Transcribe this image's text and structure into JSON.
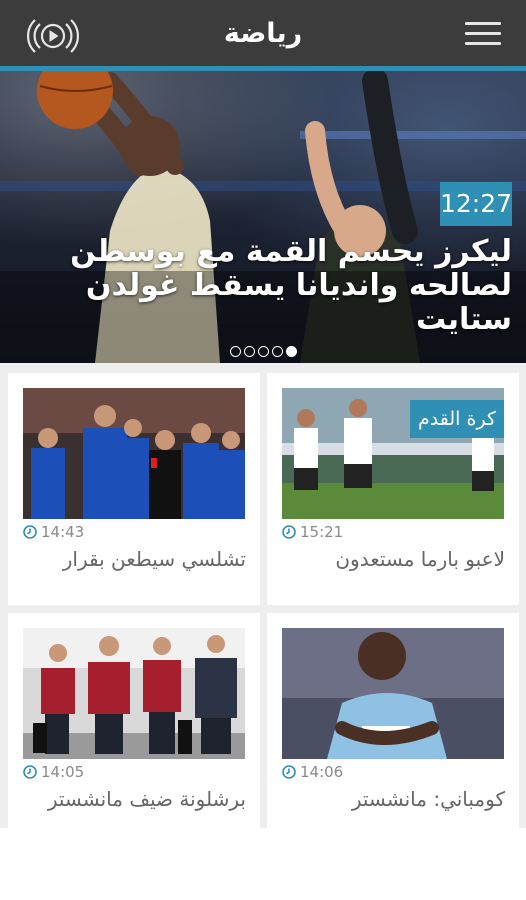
{
  "header": {
    "title": "رياضة",
    "radio_icon": "radio-play-icon",
    "menu_icon": "hamburger-menu-icon",
    "accent_color": "#2f8fb5",
    "bar_color": "#3c3c3c"
  },
  "hero": {
    "time": "12:27",
    "headline": "ليكرز يحسم القمة مع بوسطن لصالحه وانديانا يسقط غولدن ستايت",
    "slides_total": 5,
    "active_slide": 5
  },
  "articles": [
    {
      "time": "15:21",
      "headline": "لاعبو بارما مستعدون",
      "category": "كرة القدم",
      "clock_icon": "clock-icon"
    },
    {
      "time": "14:43",
      "headline": "تشلسي سيطعن بقرار",
      "clock_icon": "clock-icon"
    },
    {
      "time": "14:06",
      "headline": "كومباني: مانشستر",
      "clock_icon": "clock-icon"
    },
    {
      "time": "14:05",
      "headline": "برشلونة ضيف مانشستر",
      "clock_icon": "clock-icon"
    }
  ]
}
